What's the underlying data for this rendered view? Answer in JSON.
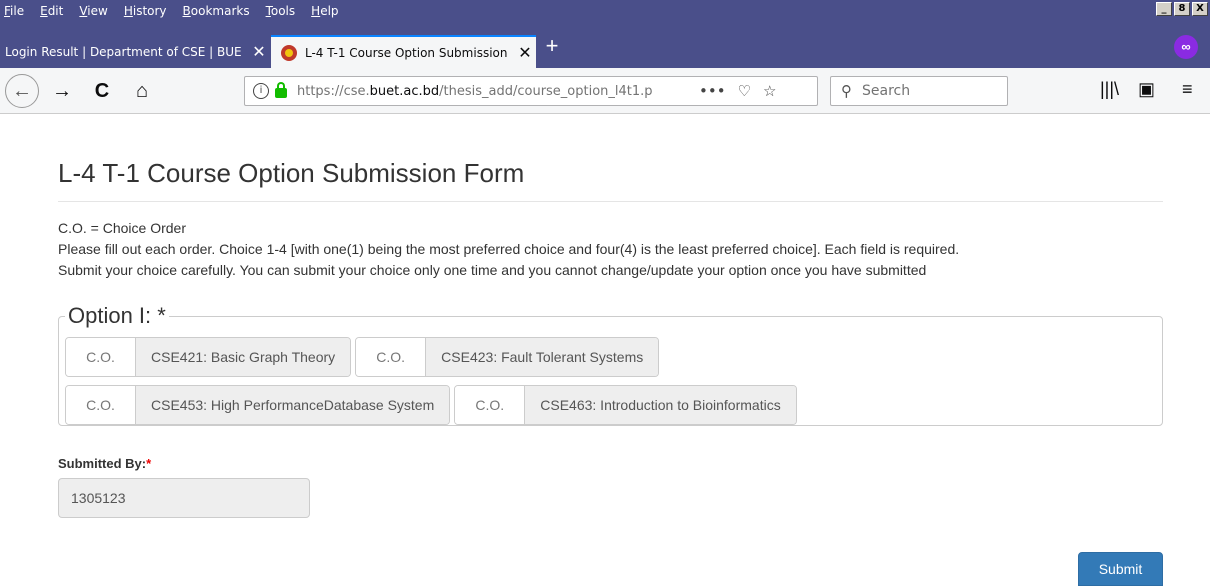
{
  "browser": {
    "menu": [
      "File",
      "Edit",
      "View",
      "History",
      "Bookmarks",
      "Tools",
      "Help"
    ],
    "window_controls": [
      "_",
      "8",
      "X"
    ],
    "tabs": [
      {
        "label": "Login Result | Department of CSE | BUE",
        "close": "✕"
      },
      {
        "label": "L-4 T-1 Course Option Submission",
        "close": "✕"
      }
    ],
    "new_tab": "+",
    "private_icon": "∞",
    "url_prefix": "https://cse.",
    "url_domain": "buet.ac.bd",
    "url_path": "/thesis_add/course_option_l4t1.p",
    "page_actions": "•••",
    "search_placeholder": "Search",
    "icons": {
      "back": "←",
      "forward": "→",
      "reload": "C",
      "home": "⌂",
      "pocket": "♡",
      "star": "☆",
      "search": "⚲",
      "library": "|||\\",
      "sidebar": "▣",
      "menu": "≡"
    }
  },
  "page": {
    "title": "L-4 T-1 Course Option Submission Form",
    "notes": [
      "C.O. = Choice Order",
      "Please fill out each order. Choice 1-4 [with one(1) being the most preferred choice and four(4) is the least preferred choice]. Each field is required.",
      "Submit your choice carefully. You can submit your choice only one time and you cannot change/update your option once you have submitted"
    ],
    "option_legend": "Option I: *",
    "co_placeholder": "C.O.",
    "courses": [
      "CSE421: Basic Graph Theory",
      "CSE423: Fault Tolerant Systems",
      "CSE453: High PerformanceDatabase System",
      "CSE463: Introduction to Bioinformatics"
    ],
    "submitted_by_label": "Submitted By:",
    "required_mark": "*",
    "submitted_by_value": "1305123",
    "submit_label": "Submit"
  }
}
